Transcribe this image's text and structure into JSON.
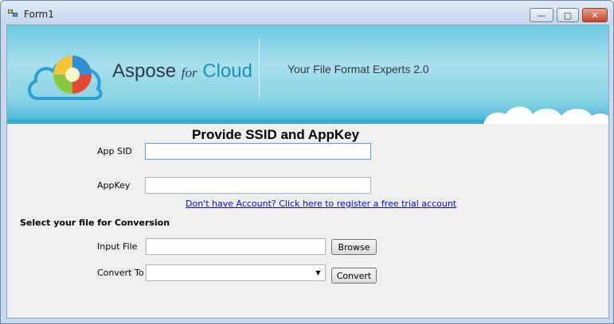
{
  "window": {
    "title": "Form1",
    "minimize_glyph": "—",
    "maximize_glyph": "▢",
    "close_glyph": "✕"
  },
  "banner": {
    "brand_main": "Aspose",
    "brand_for": "for",
    "brand_cloud": "Cloud",
    "tagline": "Your File Format Experts 2.0"
  },
  "credentials": {
    "heading": "Provide SSID and AppKey",
    "app_sid_label": "App SID",
    "app_sid_value": "",
    "appkey_label": "AppKey",
    "appkey_value": "",
    "register_link": "Don't have Account?  Click here to register a free trial account"
  },
  "conversion": {
    "section_title": "Select your file for Conversion",
    "input_file_label": "Input File",
    "input_file_value": "",
    "browse_label": "Browse",
    "convert_to_label": "Convert To",
    "convert_to_selected": "",
    "convert_label": "Convert"
  },
  "colors": {
    "banner_top": "#6ec9e0",
    "banner_band": "#36a9cf",
    "link": "#0000ee",
    "close_button": "#c8462c"
  }
}
